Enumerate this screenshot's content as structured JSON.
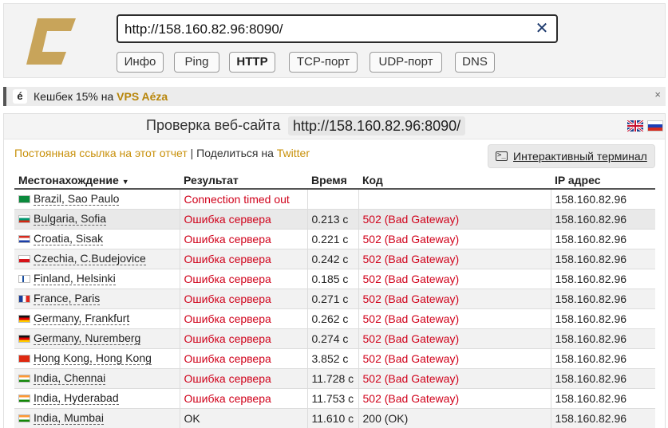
{
  "header": {
    "url_value": "http://158.160.82.96:8090/",
    "tabs": [
      "Инфо",
      "Ping",
      "HTTP",
      "TCP-порт",
      "UDP-порт",
      "DNS"
    ],
    "active_tab": "HTTP"
  },
  "promo": {
    "icon_letter": "é",
    "text": "Кешбек 15% на",
    "link": "VPS Aéza",
    "close": "×"
  },
  "panel": {
    "title": "Проверка веб-сайта",
    "url": "http://158.160.82.96:8090/",
    "permalink": "Постоянная ссылка на этот отчет",
    "separator": " | ",
    "share_prefix": "Поделиться на ",
    "share_link": "Twitter",
    "terminal_button": "Интерактивный терминал"
  },
  "table": {
    "columns": [
      "Местонахождение",
      "Результат",
      "Время",
      "Код",
      "IP адрес"
    ],
    "rows": [
      {
        "flag": "br",
        "location": "Brazil, Sao Paulo",
        "result": "Connection timed out",
        "time": "",
        "code": "",
        "ip": "158.160.82.96",
        "status": "err"
      },
      {
        "flag": "bg",
        "location": "Bulgaria, Sofia",
        "result": "Ошибка сервера",
        "time": "0.213 с",
        "code": "502 (Bad Gateway)",
        "ip": "158.160.82.96",
        "status": "err"
      },
      {
        "flag": "hr",
        "location": "Croatia, Sisak",
        "result": "Ошибка сервера",
        "time": "0.221 с",
        "code": "502 (Bad Gateway)",
        "ip": "158.160.82.96",
        "status": "err"
      },
      {
        "flag": "cz",
        "location": "Czechia, C.Budejovice",
        "result": "Ошибка сервера",
        "time": "0.242 с",
        "code": "502 (Bad Gateway)",
        "ip": "158.160.82.96",
        "status": "err"
      },
      {
        "flag": "fi",
        "location": "Finland, Helsinki",
        "result": "Ошибка сервера",
        "time": "0.185 с",
        "code": "502 (Bad Gateway)",
        "ip": "158.160.82.96",
        "status": "err"
      },
      {
        "flag": "fr",
        "location": "France, Paris",
        "result": "Ошибка сервера",
        "time": "0.271 с",
        "code": "502 (Bad Gateway)",
        "ip": "158.160.82.96",
        "status": "err"
      },
      {
        "flag": "de",
        "location": "Germany, Frankfurt",
        "result": "Ошибка сервера",
        "time": "0.262 с",
        "code": "502 (Bad Gateway)",
        "ip": "158.160.82.96",
        "status": "err"
      },
      {
        "flag": "de",
        "location": "Germany, Nuremberg",
        "result": "Ошибка сервера",
        "time": "0.274 с",
        "code": "502 (Bad Gateway)",
        "ip": "158.160.82.96",
        "status": "err"
      },
      {
        "flag": "hk",
        "location": "Hong Kong, Hong Kong",
        "result": "Ошибка сервера",
        "time": "3.852 с",
        "code": "502 (Bad Gateway)",
        "ip": "158.160.82.96",
        "status": "err"
      },
      {
        "flag": "in",
        "location": "India, Chennai",
        "result": "Ошибка сервера",
        "time": "11.728 с",
        "code": "502 (Bad Gateway)",
        "ip": "158.160.82.96",
        "status": "err"
      },
      {
        "flag": "in",
        "location": "India, Hyderabad",
        "result": "Ошибка сервера",
        "time": "11.753 с",
        "code": "502 (Bad Gateway)",
        "ip": "158.160.82.96",
        "status": "err"
      },
      {
        "flag": "in",
        "location": "India, Mumbai",
        "result": "OK",
        "time": "11.610 с",
        "code": "200 (OK)",
        "ip": "158.160.82.96",
        "status": "ok"
      }
    ]
  },
  "colors": {
    "error": "#d0021b",
    "brand_gold": "#c8a45a",
    "link_gold": "#c8900a"
  }
}
